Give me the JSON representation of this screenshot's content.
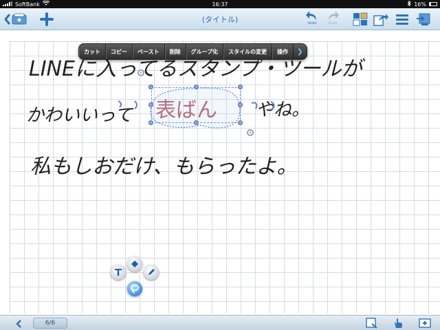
{
  "status_bar": {
    "carrier": "SoftBank",
    "time": "16:37",
    "battery": "16%"
  },
  "toolbar": {
    "title": "(タイトル)",
    "undo_label": "Undo",
    "redo_label": "Redo"
  },
  "context_menu": {
    "items": [
      "カット",
      "コピー",
      "ペースト",
      "削除",
      "グループ化",
      "スタイルの変更",
      "操作"
    ]
  },
  "canvas": {
    "handwriting": [
      "LINEに入ってるスタンプ・ツールが",
      "かわいいって",
      "表ばん",
      "やね。",
      "私もしおだけ、もらったよ。"
    ]
  },
  "bottom_bar": {
    "page_indicator": "6/6"
  },
  "colors": {
    "accent": "#2a73b8",
    "selection": "#6a8fd8",
    "ink": "#222222",
    "selected_ink": "#b0505a"
  }
}
